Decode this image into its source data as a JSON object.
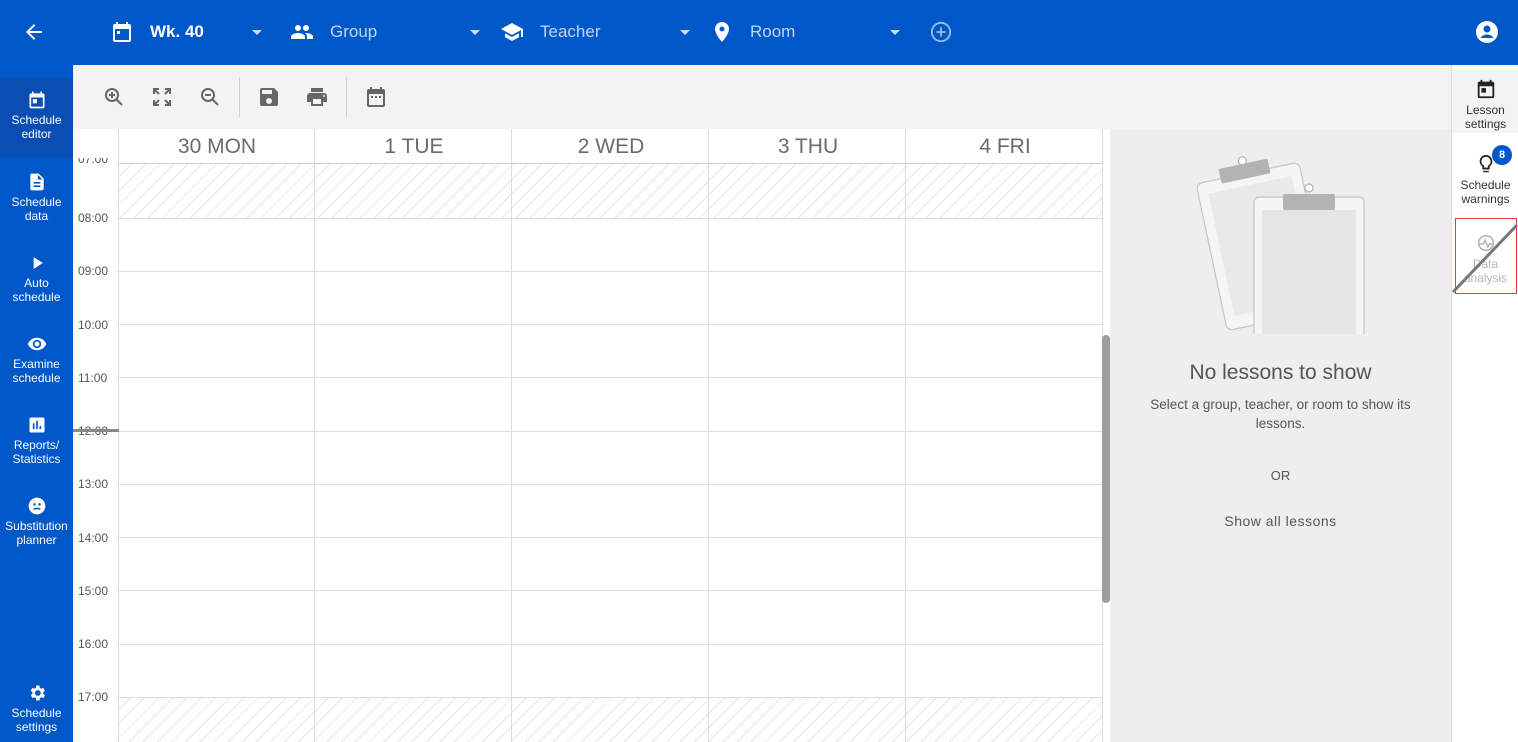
{
  "header": {
    "week_label": "Wk. 40",
    "group_label": "Group",
    "teacher_label": "Teacher",
    "room_label": "Room"
  },
  "leftnav": {
    "items": [
      {
        "label_1": "Schedule",
        "label_2": "editor",
        "icon": "calendar-today-icon",
        "active": true
      },
      {
        "label_1": "Schedule",
        "label_2": "data",
        "icon": "document-icon"
      },
      {
        "label_1": "Auto",
        "label_2": "schedule",
        "icon": "play-icon"
      },
      {
        "label_1": "Examine",
        "label_2": "schedule",
        "icon": "eye-icon"
      },
      {
        "label_1": "Reports/",
        "label_2": "Statistics",
        "icon": "bar-chart-icon"
      },
      {
        "label_1": "Substitution",
        "label_2": "planner",
        "icon": "substitution-icon"
      },
      {
        "label_1": "Schedule",
        "label_2": "settings",
        "icon": "gear-icon"
      }
    ]
  },
  "toolbar": {
    "icons": [
      "zoom-in-icon",
      "fit-screen-icon",
      "zoom-out-icon",
      "save-icon",
      "print-icon",
      "calendar-icon"
    ]
  },
  "calendar": {
    "days": [
      "30 MON",
      "1 TUE",
      "2 WED",
      "3 THU",
      "4 FRI"
    ],
    "times": [
      "07:00",
      "08:00",
      "09:00",
      "10:00",
      "11:00",
      "12:00",
      "13:00",
      "14:00",
      "15:00",
      "16:00",
      "17:00"
    ]
  },
  "panel": {
    "empty_title": "No lessons to show",
    "empty_sub": "Select a group, teacher, or room to show its lessons.",
    "or_text": "OR",
    "show_all": "Show all lessons"
  },
  "rail": {
    "lesson_settings_1": "Lesson",
    "lesson_settings_2": "settings",
    "warnings_1": "Schedule",
    "warnings_2": "warnings",
    "warnings_count": "8",
    "analysis_1": "Data",
    "analysis_2": "analysis"
  },
  "colors": {
    "brand": "#0057c8",
    "alert": "#e53935"
  }
}
